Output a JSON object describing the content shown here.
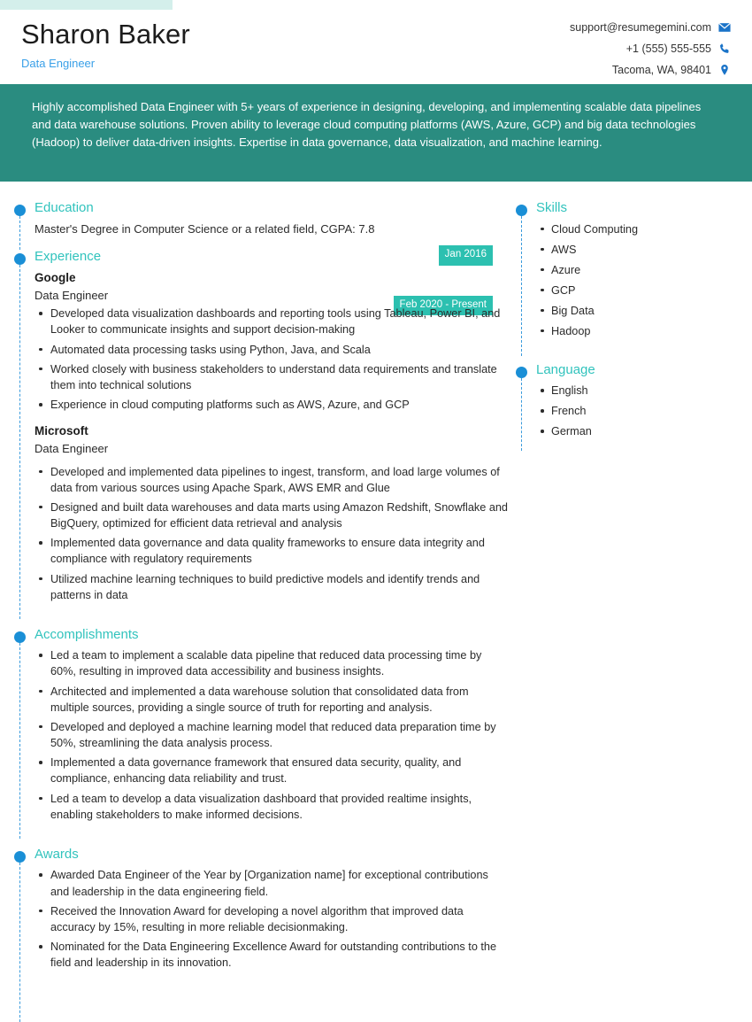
{
  "header": {
    "name": "Sharon Baker",
    "title": "Data Engineer",
    "contact": {
      "email": "support@resumegemini.com",
      "phone": "+1 (555) 555-555",
      "location": "Tacoma, WA, 98401",
      "email_icon": "envelope-icon",
      "phone_icon": "phone-icon",
      "location_icon": "map-pin-icon"
    }
  },
  "summary": {
    "text": "Highly accomplished Data Engineer with 5+ years of experience in designing, developing, and implementing scalable data pipelines and data warehouse solutions. Proven ability to leverage cloud computing platforms (AWS, Azure, GCP) and big data technologies (Hadoop) to deliver data-driven insights. Expertise in data governance, data visualization, and machine learning."
  },
  "sections": {
    "education": {
      "title": "Education",
      "entry": "Master's Degree in Computer Science or a related field, CGPA: 7.8",
      "date": "Jan 2016"
    },
    "experience": {
      "title": "Experience",
      "jobs": [
        {
          "company": "Google",
          "role": "Data Engineer",
          "date": "Feb 2020 - Present",
          "bullets": [
            "Developed data visualization dashboards and reporting tools using Tableau, Power BI, and Looker to communicate insights and support decision-making",
            "Automated data processing tasks using Python, Java, and Scala",
            "Worked closely with business stakeholders to understand data requirements and translate them into technical solutions",
            "Experience in cloud computing platforms such as AWS, Azure, and GCP"
          ]
        },
        {
          "company": "Microsoft",
          "role": "Data Engineer",
          "date": "",
          "bullets": [
            "Developed and implemented data pipelines to ingest, transform, and load large volumes of data from various sources using Apache Spark, AWS EMR and Glue",
            "Designed and built data warehouses and data marts using Amazon Redshift, Snowflake and BigQuery, optimized for efficient data retrieval and analysis",
            "Implemented data governance and data quality frameworks to ensure data integrity and compliance with regulatory requirements",
            "Utilized machine learning techniques to build predictive models and identify trends and patterns in data"
          ]
        }
      ]
    },
    "accomplishments": {
      "title": "Accomplishments",
      "bullets": [
        "Led a team to implement a scalable data pipeline that reduced data processing time by 60%, resulting in improved data accessibility and business insights.",
        "Architected and implemented a data warehouse solution that consolidated data from multiple sources, providing a single source of truth for reporting and analysis.",
        "Developed and deployed a machine learning model that reduced data preparation time by 50%, streamlining the data analysis process.",
        "Implemented a data governance framework that ensured data security, quality, and compliance, enhancing data reliability and trust.",
        "Led a team to develop a data visualization dashboard that provided realtime insights, enabling stakeholders to make informed decisions."
      ]
    },
    "awards": {
      "title": "Awards",
      "bullets": [
        "Awarded Data Engineer of the Year by [Organization name] for exceptional contributions and leadership in the data engineering field.",
        "Received the Innovation Award for developing a novel algorithm that improved data accuracy by 15%, resulting in more reliable decisionmaking.",
        "Nominated for the Data Engineering Excellence Award for outstanding contributions to the field and leadership in its innovation."
      ]
    },
    "skills": {
      "title": "Skills",
      "items": [
        "Cloud Computing",
        "AWS",
        "Azure",
        "GCP",
        "Big Data",
        "Hadoop"
      ]
    },
    "language": {
      "title": "Language",
      "items": [
        "English",
        "French",
        "German"
      ]
    }
  },
  "colors": {
    "accent_teal": "#2a8c80",
    "badge_teal": "#2cc0b0",
    "heading_teal": "#31c3bd",
    "dot_blue": "#1a8fd6",
    "icon_blue": "#1a73c8",
    "top_bar": "#d4efeb"
  }
}
